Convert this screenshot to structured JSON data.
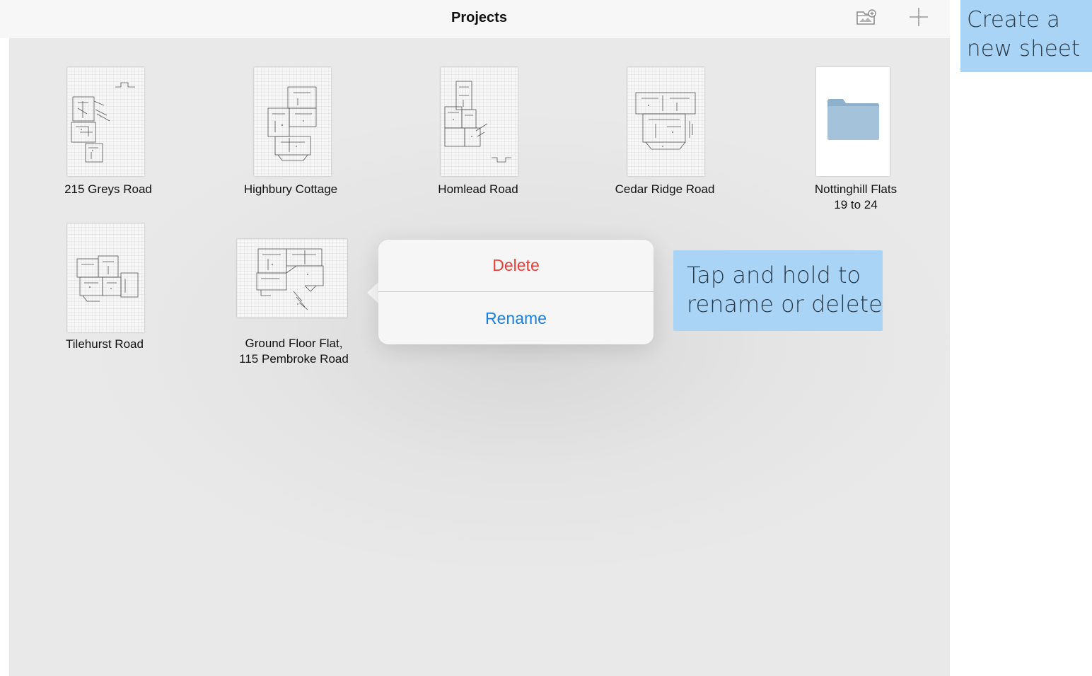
{
  "navbar": {
    "title": "Projects",
    "import_icon": "folder-import-icon",
    "add_icon": "plus-icon"
  },
  "projects": [
    {
      "label": "215 Greys Road",
      "type": "plan"
    },
    {
      "label": "Highbury Cottage",
      "type": "plan"
    },
    {
      "label": "Homlead Road",
      "type": "plan"
    },
    {
      "label": "Cedar Ridge Road",
      "type": "plan"
    },
    {
      "label": "Nottinghill Flats\n19 to 24",
      "type": "folder"
    },
    {
      "label": "Tilehurst Road",
      "type": "plan"
    },
    {
      "label": "Ground Floor Flat,\n115 Pembroke Road",
      "type": "plan"
    }
  ],
  "popover": {
    "delete_label": "Delete",
    "rename_label": "Rename"
  },
  "callouts": {
    "create_line1": "Create a",
    "create_line2": "new sheet",
    "tap_line1": "Tap and hold to",
    "tap_line2": "rename or delete"
  },
  "colors": {
    "destructive": "#e8413a",
    "action": "#1c7fe0",
    "callout_bg": "#a9d4f5",
    "folder": "#9ab8d3"
  }
}
